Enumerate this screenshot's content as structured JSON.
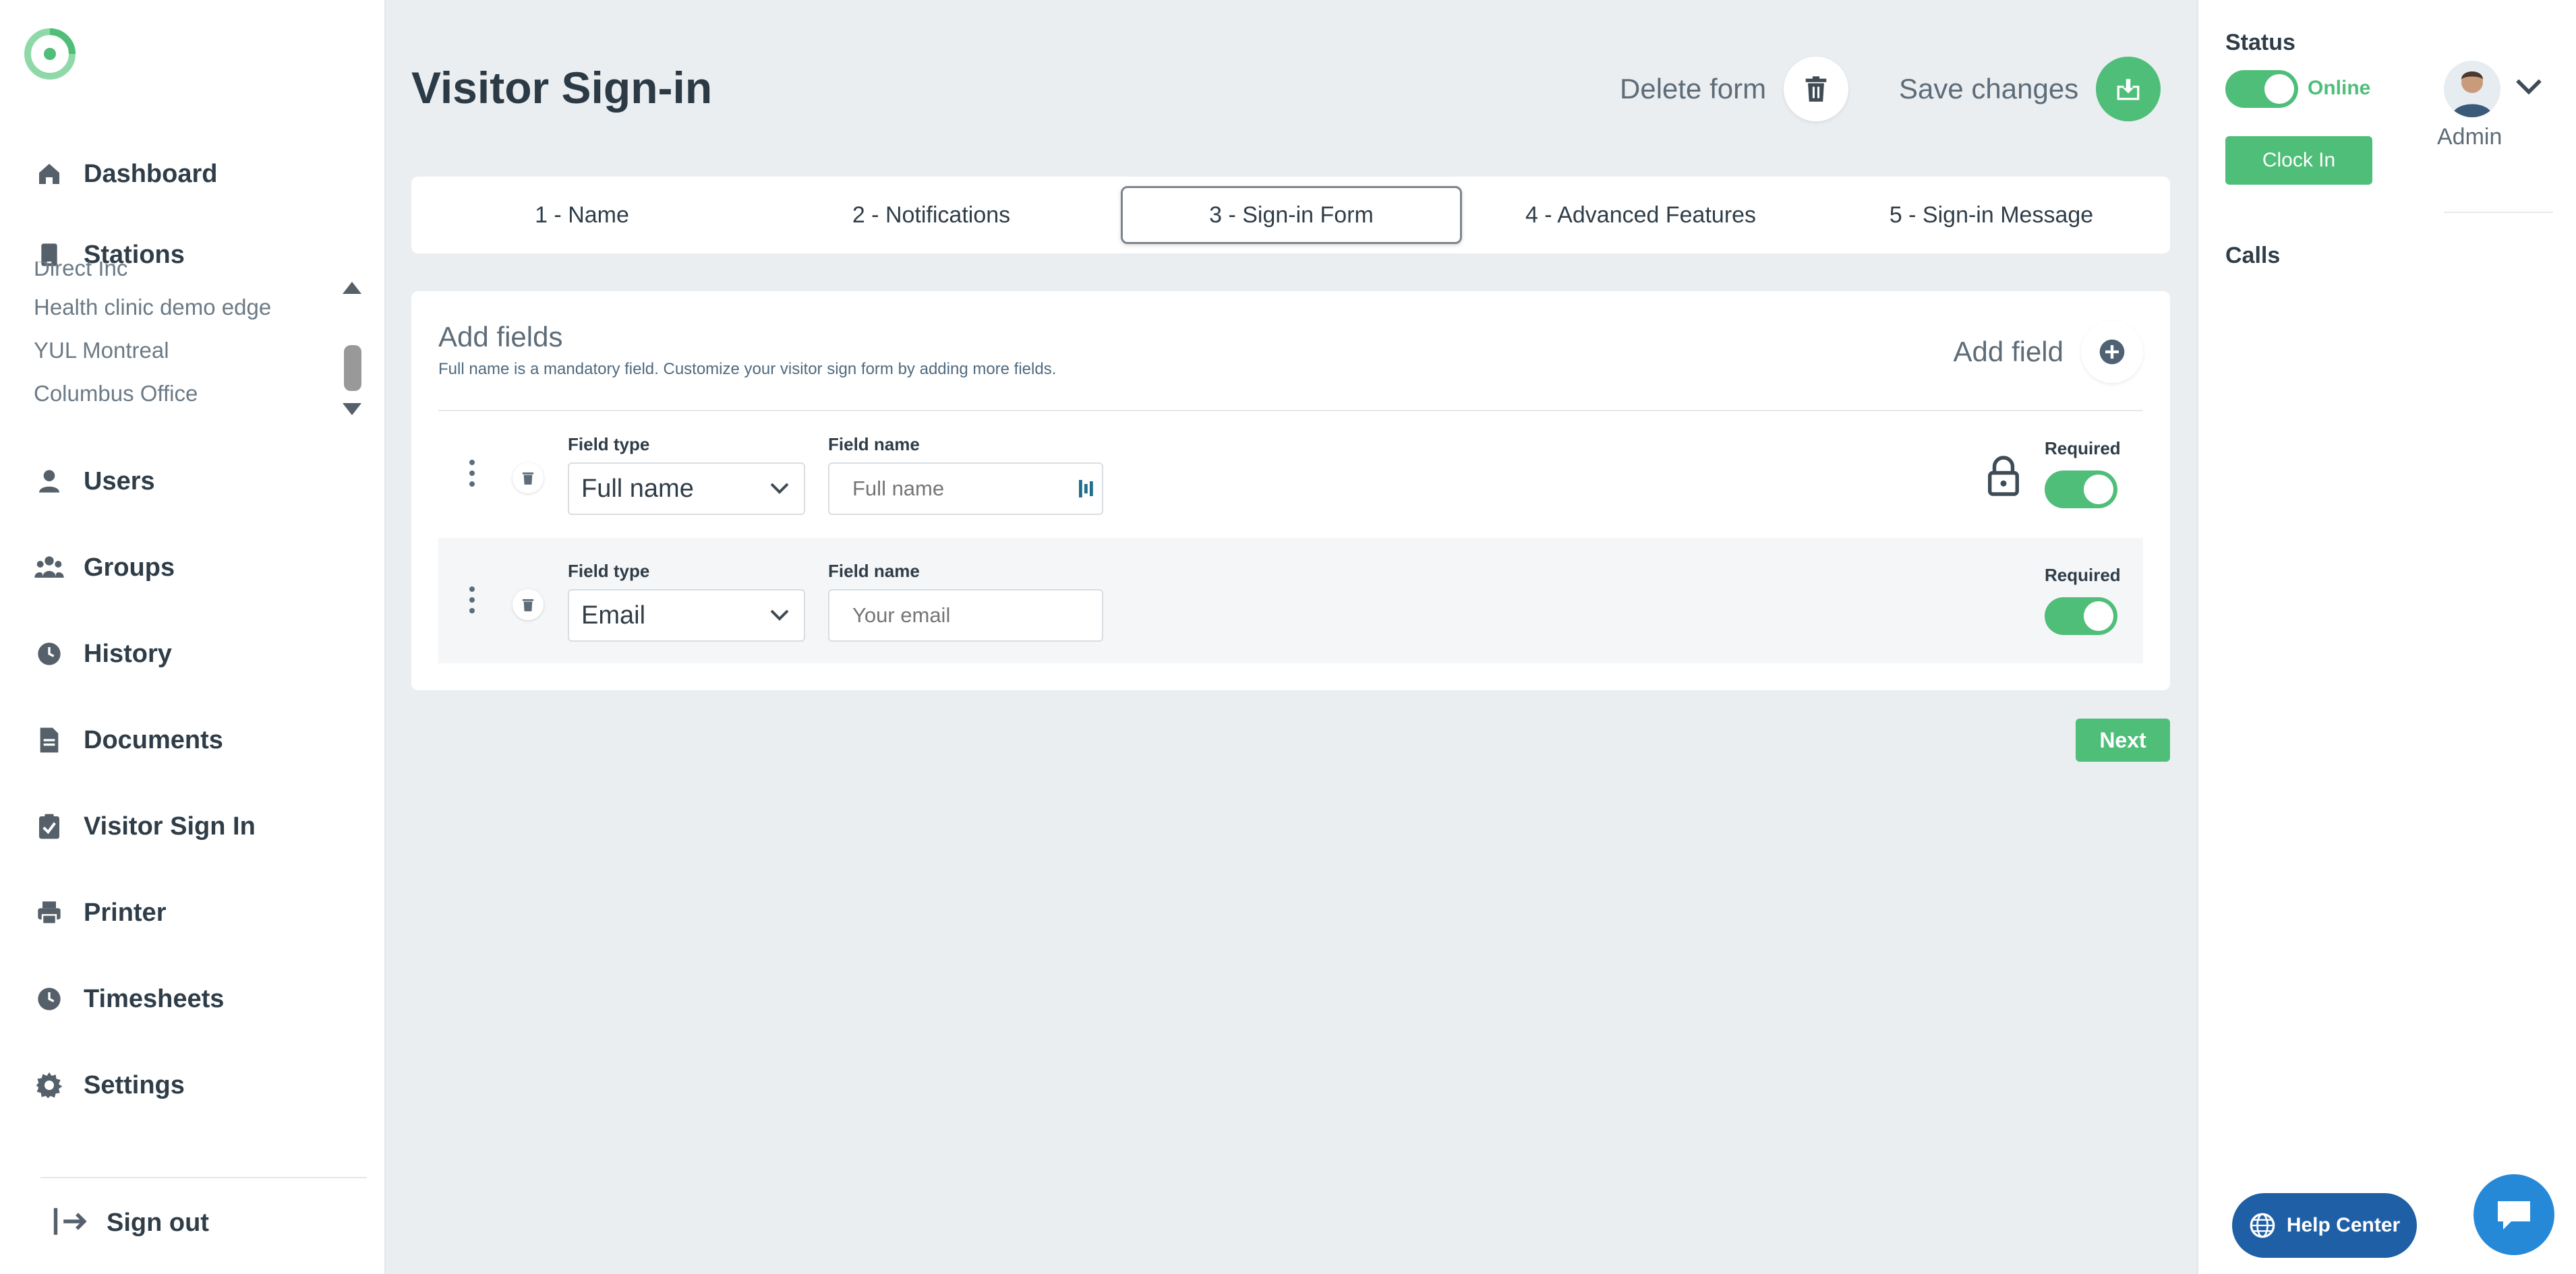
{
  "sidebar": {
    "nav": [
      {
        "label": "Dashboard",
        "icon": "home-icon"
      },
      {
        "label": "Stations",
        "icon": "tablet-icon"
      },
      {
        "label": "Users",
        "icon": "user-icon"
      },
      {
        "label": "Groups",
        "icon": "group-icon"
      },
      {
        "label": "History",
        "icon": "clock-icon"
      },
      {
        "label": "Documents",
        "icon": "document-icon"
      },
      {
        "label": "Visitor Sign In",
        "icon": "clipboard-check-icon"
      },
      {
        "label": "Printer",
        "icon": "printer-icon"
      },
      {
        "label": "Timesheets",
        "icon": "clock-icon"
      },
      {
        "label": "Settings",
        "icon": "gear-icon"
      }
    ],
    "stations": [
      "Direct Inc",
      "Health clinic demo edge",
      "YUL Montreal",
      "Columbus Office"
    ],
    "signout_label": "Sign out"
  },
  "header": {
    "title": "Visitor Sign-in",
    "delete_label": "Delete form",
    "save_label": "Save changes"
  },
  "tabs": [
    {
      "label": "1 - Name",
      "active": false
    },
    {
      "label": "2 - Notifications",
      "active": false
    },
    {
      "label": "3 - Sign-in Form",
      "active": true
    },
    {
      "label": "4 - Advanced Features",
      "active": false
    },
    {
      "label": "5 - Sign-in Message",
      "active": false
    }
  ],
  "form": {
    "title": "Add fields",
    "subtitle": "Full name is a mandatory field. Customize your visitor sign form by adding more fields.",
    "add_field_label": "Add field",
    "field_type_label": "Field type",
    "field_name_label": "Field name",
    "required_label": "Required",
    "fields": [
      {
        "type": "Full name",
        "name_placeholder": "Full name",
        "required": true,
        "locked": true
      },
      {
        "type": "Email",
        "name_placeholder": "Your email",
        "required": true,
        "locked": false
      }
    ],
    "next_label": "Next"
  },
  "right_panel": {
    "status_title": "Status",
    "status_value": "Online",
    "user_label": "Admin",
    "clockin_label": "Clock In",
    "calls_title": "Calls",
    "help_label": "Help Center"
  },
  "colors": {
    "accent": "#4fbe79",
    "help_blue": "#1f5fa5",
    "chat_blue": "#2589d8"
  }
}
